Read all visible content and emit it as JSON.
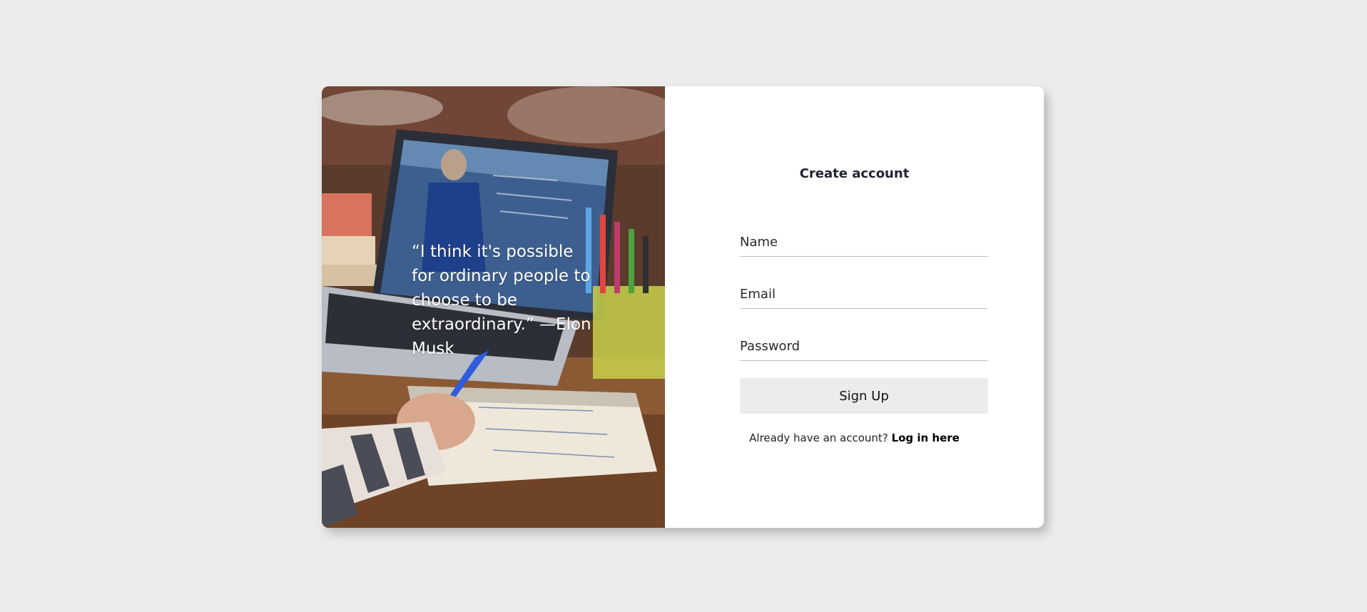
{
  "hero": {
    "quote": "“I think it's possible for ordinary people to choose to be extraordinary.” —Elon Musk"
  },
  "form": {
    "title": "Create account",
    "name_placeholder": "Name",
    "email_placeholder": "Email",
    "password_placeholder": "Password",
    "signup_label": "Sign Up",
    "login_prompt": "Already have an account?",
    "login_link": "Log in here"
  },
  "colors": {
    "page_background": "#ececec",
    "card_background": "#ffffff",
    "button_background": "#ececec",
    "title_text": "#1f2333"
  }
}
